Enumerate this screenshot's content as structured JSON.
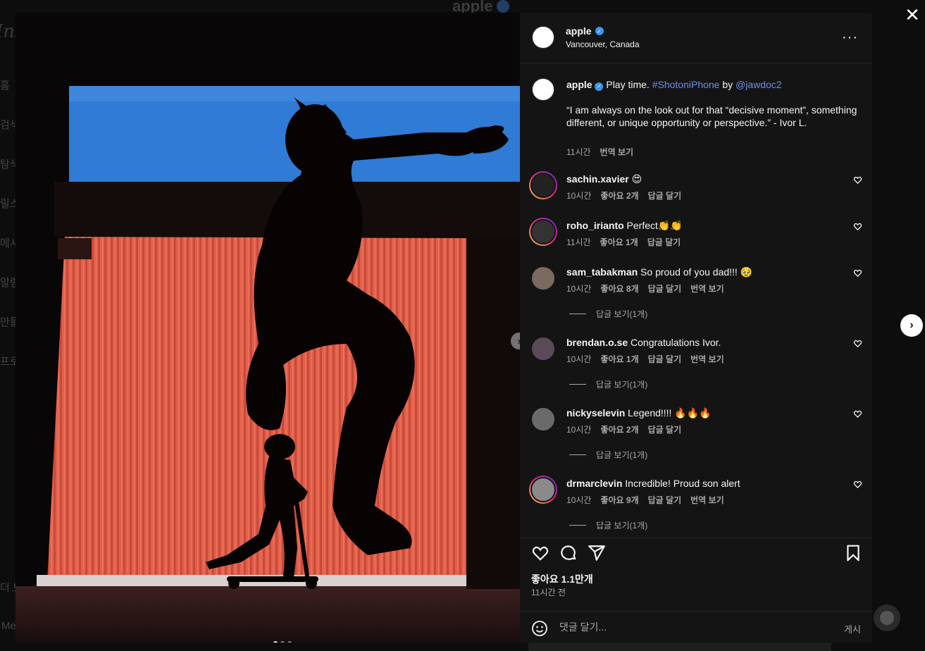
{
  "background": {
    "logo": "Instag",
    "nav": [
      "홈",
      "검색",
      "탐색",
      "릴스",
      "메시",
      "알림",
      "만들",
      "프로"
    ],
    "more": "더 보기",
    "meta": "Meta",
    "title": "apple",
    "dots": "···"
  },
  "post": {
    "username": "apple",
    "location": "Vancouver, Canada",
    "more": "···",
    "close": "✕",
    "next_post": "›",
    "carousel_next": "›",
    "carousel": {
      "count": 3,
      "active": 0
    }
  },
  "caption": {
    "username": "apple",
    "text": " Play time. ",
    "hashtag": "#ShotoniPhone",
    "by": " by ",
    "mention": "@jawdoc2",
    "quote": "“I am always on the look out for that “decisive moment”, something different, or unique opportunity or perspective.” - Ivor L.",
    "time": "11시간",
    "translate": "번역 보기"
  },
  "comments": [
    {
      "username": "sachin.xavier",
      "text": " 😍",
      "time": "10시간",
      "likes": "좋아요 2개",
      "reply": "답글 달기",
      "translate": "",
      "view_replies": ""
    },
    {
      "username": "roho_irianto",
      "text": " Perfect👏👏",
      "time": "11시간",
      "likes": "좋아요 1개",
      "reply": "답글 달기",
      "translate": "",
      "view_replies": ""
    },
    {
      "username": "sam_tabakman",
      "text": " So proud of you dad!!! 🥹",
      "time": "10시간",
      "likes": "좋아요 8개",
      "reply": "답글 달기",
      "translate": "번역 보기",
      "view_replies": "답글 보기(1개)"
    },
    {
      "username": "brendan.o.se",
      "text": " Congratulations Ivor.",
      "time": "10시간",
      "likes": "좋아요 1개",
      "reply": "답글 달기",
      "translate": "번역 보기",
      "view_replies": "답글 보기(1개)"
    },
    {
      "username": "nickyselevin",
      "text": " Legend!!!! 🔥🔥🔥",
      "time": "10시간",
      "likes": "좋아요 2개",
      "reply": "답글 달기",
      "translate": "",
      "view_replies": "답글 보기(1개)"
    },
    {
      "username": "drmarclevin",
      "text": " Incredible! Proud son alert",
      "time": "10시간",
      "likes": "좋아요 9개",
      "reply": "답글 달기",
      "translate": "번역 보기",
      "view_replies": "답글 보기(1개)"
    }
  ],
  "footer": {
    "likes": "좋아요 1.1만개",
    "ago": "11시간 전",
    "comment_placeholder": "댓글 달기...",
    "post_button": "게시"
  },
  "icons": {
    "heart": "heart-icon",
    "comment": "comment-icon",
    "share": "share-icon",
    "bookmark": "bookmark-icon",
    "emoji": "emoji-icon",
    "apple": ""
  },
  "colors": {
    "accent_link": "#6f8ee6",
    "verified": "#3897f0",
    "panel_bg": "#141414"
  }
}
